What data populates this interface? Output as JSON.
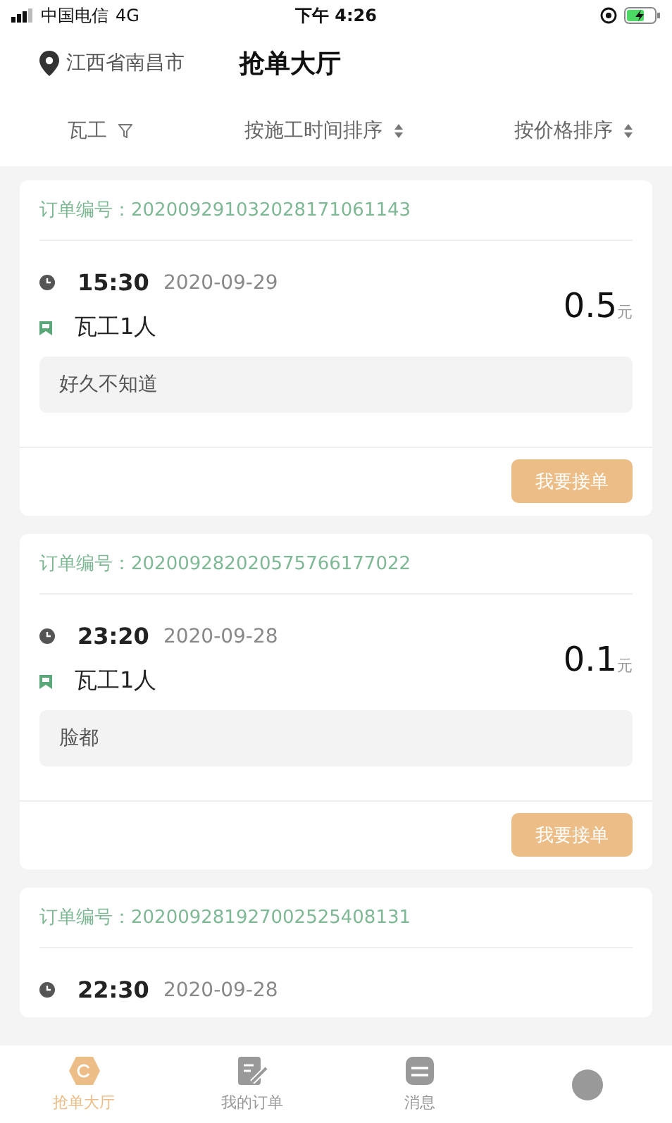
{
  "status_bar": {
    "carrier": "中国电信",
    "network": "4G",
    "time": "下午 4:26"
  },
  "header": {
    "location": "江西省南昌市",
    "title": "抢单大厅"
  },
  "filters": [
    {
      "label": "瓦工",
      "kind": "filter"
    },
    {
      "label": "按施工时间排序",
      "kind": "sort"
    },
    {
      "label": "按价格排序",
      "kind": "sort"
    }
  ],
  "orders": [
    {
      "order_label": "订单编号：",
      "order_no": "202009291032028171061143",
      "time": "15:30",
      "date": "2020-09-29",
      "workers": "瓦工1人",
      "price": "0.5",
      "unit": "元",
      "note": "好久不知道",
      "action": "我要接单"
    },
    {
      "order_label": "订单编号：",
      "order_no": "202009282020575766177022",
      "time": "23:20",
      "date": "2020-09-28",
      "workers": "瓦工1人",
      "price": "0.1",
      "unit": "元",
      "note": "脸都",
      "action": "我要接单"
    },
    {
      "order_label": "订单编号：",
      "order_no": "202009281927002525408131",
      "time": "22:30",
      "date": "2020-09-28"
    }
  ],
  "tabs": [
    {
      "label": "抢单大厅",
      "kind": "hexagon",
      "selected": true
    },
    {
      "label": "我的订单",
      "kind": "edit",
      "selected": false
    },
    {
      "label": "消息",
      "kind": "message",
      "selected": false
    },
    {
      "kind": "profile",
      "selected": false
    }
  ]
}
